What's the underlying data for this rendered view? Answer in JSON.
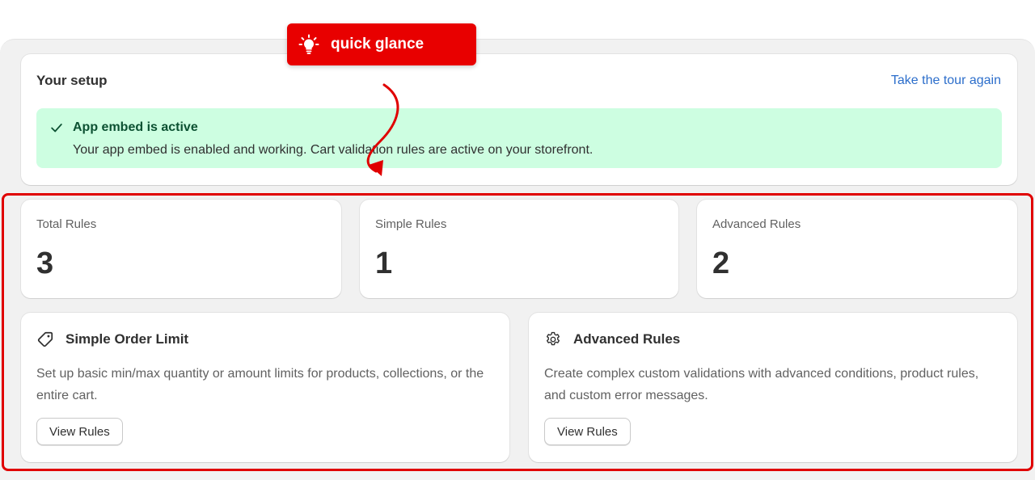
{
  "setup": {
    "title": "Your setup",
    "tour_link": "Take the tour again",
    "banner": {
      "title": "App embed is active",
      "text": "Your app embed is enabled and working. Cart validation rules are active on your storefront.",
      "icon": "checkmark-icon"
    }
  },
  "stats": [
    {
      "label": "Total Rules",
      "value": "3"
    },
    {
      "label": "Simple Rules",
      "value": "1"
    },
    {
      "label": "Advanced Rules",
      "value": "2"
    }
  ],
  "features": [
    {
      "icon": "tag-icon",
      "title": "Simple Order Limit",
      "description": "Set up basic min/max quantity or amount limits for products, collections, or the entire cart.",
      "button": "View Rules"
    },
    {
      "icon": "gear-icon",
      "title": "Advanced Rules",
      "description": "Create complex custom validations with advanced conditions, product rules, and custom error messages.",
      "button": "View Rules"
    }
  ],
  "annotation": {
    "callout_text": "quick glance",
    "callout_icon": "lightbulb-icon",
    "color": "#e80000"
  },
  "colors": {
    "link": "#2c6ecb",
    "banner_bg": "#cdfee1",
    "banner_title": "#0c5132"
  }
}
